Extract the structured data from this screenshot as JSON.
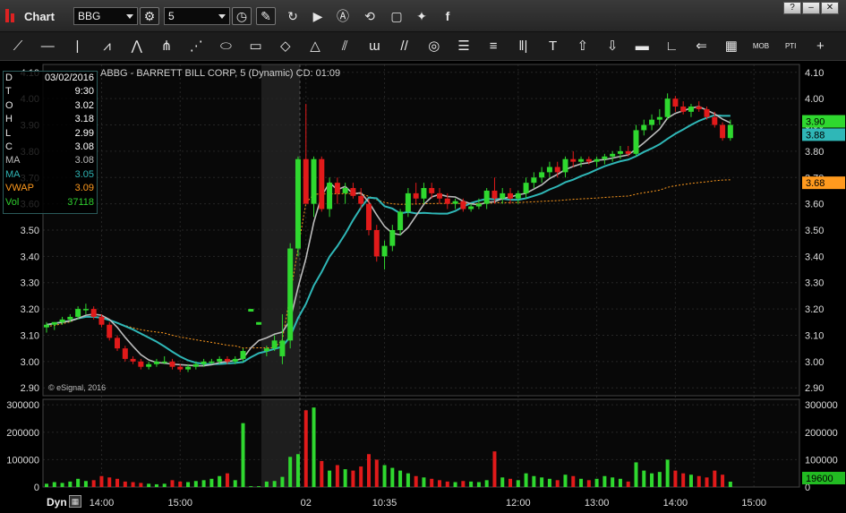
{
  "window": {
    "title": "Chart"
  },
  "toolbar": {
    "symbol": "BBG",
    "interval": "5",
    "buttons": [
      {
        "name": "settings-icon",
        "glyph": "⚙"
      },
      {
        "name": "clock-icon",
        "glyph": "◷"
      },
      {
        "name": "pencil-icon",
        "glyph": "✎"
      },
      {
        "name": "refresh-icon",
        "glyph": "↻"
      },
      {
        "name": "play-icon",
        "glyph": "▶"
      },
      {
        "name": "alert-icon",
        "glyph": "Ⓐ"
      },
      {
        "name": "link-icon",
        "glyph": "⟲"
      },
      {
        "name": "comment-icon",
        "glyph": "▢"
      },
      {
        "name": "twitter-icon",
        "glyph": "🐦"
      },
      {
        "name": "facebook-icon",
        "glyph": "f"
      }
    ],
    "window_buttons": [
      "?",
      "–",
      "□",
      "✕"
    ]
  },
  "drawing_tools": [
    {
      "name": "trendline-tool",
      "glyph": "⟋"
    },
    {
      "name": "horizontal-line-tool",
      "glyph": "—"
    },
    {
      "name": "vertical-line-tool",
      "glyph": "|"
    },
    {
      "name": "wave-tool",
      "glyph": "⩘"
    },
    {
      "name": "fan-tool",
      "glyph": "⋀"
    },
    {
      "name": "pitchfork-tool",
      "glyph": "⋔"
    },
    {
      "name": "gann-fan-tool",
      "glyph": "⋰"
    },
    {
      "name": "ellipse-tool",
      "glyph": "⬭"
    },
    {
      "name": "rectangle-tool",
      "glyph": "▭"
    },
    {
      "name": "eraser-tool",
      "glyph": "◇"
    },
    {
      "name": "triangle-tool",
      "glyph": "△"
    },
    {
      "name": "channel-tool",
      "glyph": "⫽"
    },
    {
      "name": "cycle-tool",
      "glyph": "ɯ"
    },
    {
      "name": "parallel-lines-tool",
      "glyph": "//"
    },
    {
      "name": "circles-tool",
      "glyph": "◎"
    },
    {
      "name": "fibonacci-tool",
      "glyph": "☰"
    },
    {
      "name": "fib-extension-tool",
      "glyph": "≡"
    },
    {
      "name": "time-zones-tool",
      "glyph": "‖|"
    },
    {
      "name": "text-tool",
      "glyph": "T"
    },
    {
      "name": "arrow-up-tool",
      "glyph": "⇧"
    },
    {
      "name": "arrow-down-tool",
      "glyph": "⇩"
    },
    {
      "name": "regression-tool",
      "glyph": "▬"
    },
    {
      "name": "angle-tool",
      "glyph": "∟"
    },
    {
      "name": "arrow-left-tool",
      "glyph": "⇐"
    },
    {
      "name": "grid-tool",
      "glyph": "▦"
    },
    {
      "name": "mob-tool",
      "glyph": "MOB"
    },
    {
      "name": "pti-tool",
      "glyph": "PTI"
    },
    {
      "name": "add-tool",
      "glyph": "+"
    }
  ],
  "chart_header": "ABBG - BARRETT BILL CORP, 5 (Dynamic) CD: 01:09",
  "watermark": "© eSignal, 2016",
  "data_window": [
    {
      "k": "D",
      "v": "03/02/2016",
      "color": "#ffffff"
    },
    {
      "k": "T",
      "v": "9:30",
      "color": "#ffffff"
    },
    {
      "k": "O",
      "v": "3.02",
      "color": "#ffffff"
    },
    {
      "k": "H",
      "v": "3.18",
      "color": "#ffffff"
    },
    {
      "k": "L",
      "v": "2.99",
      "color": "#ffffff"
    },
    {
      "k": "C",
      "v": "3.08",
      "color": "#ffffff"
    },
    {
      "k": "MA",
      "v": "3.08",
      "color": "#bbbbbb"
    },
    {
      "k": "MA",
      "v": "3.05",
      "color": "#2fb4b4"
    },
    {
      "k": "VWAP",
      "v": "3.09",
      "color": "#ff9a1e"
    },
    {
      "k": "Vol",
      "v": "37118",
      "color": "#2fd02f"
    }
  ],
  "bottom": {
    "mode": "Dyn"
  },
  "colors": {
    "up": "#2fd82f",
    "down": "#e11a1a",
    "ma1": "#bcbcbc",
    "ma2": "#2fb7b7",
    "vwap": "#ff9a1e",
    "vol_tag": "#22bb22",
    "vwap_tag": "#ff9a1e",
    "price_tag": "#2fd82f"
  },
  "chart_data": {
    "type": "candlestick",
    "price_axis": {
      "ylim": [
        2.87,
        4.13
      ],
      "ticks": [
        "2.90",
        "3.00",
        "3.10",
        "3.20",
        "3.30",
        "3.40",
        "3.50",
        "3.60",
        "3.70",
        "3.80",
        "3.90",
        "4.00",
        "4.10"
      ]
    },
    "volume_axis": {
      "ylim": [
        0,
        320000
      ],
      "ticks": [
        "0",
        "100000",
        "200000",
        "300000"
      ]
    },
    "x_ticks": [
      {
        "label": "14:00",
        "bar": 7
      },
      {
        "label": "15:00",
        "bar": 17
      },
      {
        "label": "02",
        "bar": 33
      },
      {
        "label": "10:35",
        "bar": 43
      },
      {
        "label": "12:00",
        "bar": 60
      },
      {
        "label": "13:00",
        "bar": 70
      },
      {
        "label": "14:00",
        "bar": 80
      },
      {
        "label": "15:00",
        "bar": 90
      }
    ],
    "last_values": {
      "price": "3.90",
      "ma2": "3.88",
      "vwap": "3.68",
      "volume": "19600"
    },
    "bars": [
      [
        3.13,
        3.15,
        3.11,
        3.14,
        12000
      ],
      [
        3.14,
        3.15,
        3.12,
        3.15,
        18000
      ],
      [
        3.15,
        3.17,
        3.14,
        3.16,
        15000
      ],
      [
        3.16,
        3.18,
        3.15,
        3.17,
        20000
      ],
      [
        3.17,
        3.21,
        3.16,
        3.2,
        30000
      ],
      [
        3.2,
        3.22,
        3.18,
        3.2,
        22000
      ],
      [
        3.2,
        3.21,
        3.16,
        3.17,
        25000
      ],
      [
        3.17,
        3.18,
        3.13,
        3.14,
        40000
      ],
      [
        3.14,
        3.15,
        3.08,
        3.09,
        35000
      ],
      [
        3.09,
        3.1,
        3.04,
        3.05,
        30000
      ],
      [
        3.05,
        3.06,
        3.0,
        3.01,
        20000
      ],
      [
        3.01,
        3.02,
        2.99,
        3.0,
        18000
      ],
      [
        3.0,
        3.01,
        2.97,
        2.98,
        15000
      ],
      [
        2.98,
        3.0,
        2.97,
        2.99,
        12000
      ],
      [
        2.99,
        3.01,
        2.98,
        3.0,
        10000
      ],
      [
        3.0,
        3.02,
        2.99,
        3.0,
        12000
      ],
      [
        3.0,
        3.01,
        2.97,
        2.98,
        25000
      ],
      [
        2.98,
        2.99,
        2.96,
        2.97,
        20000
      ],
      [
        2.97,
        2.99,
        2.96,
        2.98,
        18000
      ],
      [
        2.98,
        3.0,
        2.97,
        2.99,
        22000
      ],
      [
        2.99,
        3.01,
        2.98,
        3.0,
        25000
      ],
      [
        3.0,
        3.01,
        2.99,
        3.0,
        30000
      ],
      [
        3.0,
        3.02,
        2.99,
        3.01,
        40000
      ],
      [
        3.01,
        3.02,
        2.99,
        3.0,
        50000
      ],
      [
        3.0,
        3.02,
        2.99,
        3.01,
        25000
      ],
      [
        3.01,
        3.05,
        3.0,
        3.04,
        233000
      ],
      [
        3.19,
        3.2,
        3.19,
        3.2,
        3000
      ],
      [
        3.14,
        3.15,
        3.14,
        3.15,
        3000
      ],
      [
        3.04,
        3.06,
        3.02,
        3.05,
        20000
      ],
      [
        3.05,
        3.1,
        3.04,
        3.08,
        22000
      ],
      [
        3.02,
        3.18,
        2.99,
        3.08,
        37118
      ],
      [
        3.08,
        3.45,
        3.05,
        3.43,
        110000
      ],
      [
        3.43,
        3.78,
        3.4,
        3.77,
        120000
      ],
      [
        3.77,
        3.98,
        3.72,
        3.6,
        280000
      ],
      [
        3.6,
        3.78,
        3.55,
        3.77,
        290000
      ],
      [
        3.77,
        3.78,
        3.57,
        3.58,
        95000
      ],
      [
        3.58,
        3.7,
        3.55,
        3.68,
        60000
      ],
      [
        3.68,
        3.7,
        3.6,
        3.64,
        80000
      ],
      [
        3.64,
        3.68,
        3.6,
        3.66,
        65000
      ],
      [
        3.66,
        3.68,
        3.62,
        3.63,
        60000
      ],
      [
        3.63,
        3.66,
        3.58,
        3.6,
        75000
      ],
      [
        3.6,
        3.62,
        3.48,
        3.5,
        120000
      ],
      [
        3.5,
        3.52,
        3.38,
        3.4,
        100000
      ],
      [
        3.4,
        3.46,
        3.35,
        3.44,
        80000
      ],
      [
        3.44,
        3.52,
        3.42,
        3.5,
        70000
      ],
      [
        3.5,
        3.58,
        3.48,
        3.57,
        60000
      ],
      [
        3.57,
        3.66,
        3.55,
        3.64,
        50000
      ],
      [
        3.64,
        3.68,
        3.6,
        3.62,
        40000
      ],
      [
        3.62,
        3.68,
        3.6,
        3.66,
        35000
      ],
      [
        3.66,
        3.68,
        3.62,
        3.64,
        30000
      ],
      [
        3.64,
        3.66,
        3.6,
        3.62,
        25000
      ],
      [
        3.62,
        3.64,
        3.58,
        3.6,
        20000
      ],
      [
        3.6,
        3.62,
        3.58,
        3.61,
        18000
      ],
      [
        3.61,
        3.62,
        3.57,
        3.58,
        22000
      ],
      [
        3.58,
        3.6,
        3.57,
        3.59,
        20000
      ],
      [
        3.59,
        3.62,
        3.58,
        3.6,
        18000
      ],
      [
        3.6,
        3.66,
        3.58,
        3.65,
        25000
      ],
      [
        3.65,
        3.7,
        3.6,
        3.62,
        130000
      ],
      [
        3.62,
        3.66,
        3.6,
        3.64,
        35000
      ],
      [
        3.64,
        3.66,
        3.6,
        3.62,
        30000
      ],
      [
        3.62,
        3.65,
        3.6,
        3.64,
        25000
      ],
      [
        3.64,
        3.7,
        3.62,
        3.68,
        50000
      ],
      [
        3.68,
        3.72,
        3.66,
        3.7,
        40000
      ],
      [
        3.7,
        3.74,
        3.68,
        3.72,
        35000
      ],
      [
        3.72,
        3.76,
        3.7,
        3.74,
        30000
      ],
      [
        3.74,
        3.76,
        3.7,
        3.72,
        25000
      ],
      [
        3.72,
        3.78,
        3.7,
        3.77,
        45000
      ],
      [
        3.77,
        3.8,
        3.74,
        3.76,
        40000
      ],
      [
        3.76,
        3.78,
        3.74,
        3.77,
        30000
      ],
      [
        3.77,
        3.78,
        3.75,
        3.76,
        25000
      ],
      [
        3.76,
        3.78,
        3.74,
        3.77,
        30000
      ],
      [
        3.77,
        3.79,
        3.75,
        3.78,
        40000
      ],
      [
        3.78,
        3.8,
        3.76,
        3.79,
        35000
      ],
      [
        3.79,
        3.82,
        3.77,
        3.8,
        30000
      ],
      [
        3.8,
        3.82,
        3.78,
        3.79,
        20000
      ],
      [
        3.79,
        3.9,
        3.78,
        3.88,
        90000
      ],
      [
        3.88,
        3.92,
        3.86,
        3.9,
        60000
      ],
      [
        3.9,
        3.94,
        3.88,
        3.92,
        50000
      ],
      [
        3.92,
        3.96,
        3.9,
        3.93,
        55000
      ],
      [
        3.93,
        4.02,
        3.92,
        4.0,
        100000
      ],
      [
        4.0,
        4.01,
        3.95,
        3.97,
        60000
      ],
      [
        3.97,
        3.99,
        3.94,
        3.95,
        50000
      ],
      [
        3.95,
        3.98,
        3.93,
        3.97,
        45000
      ],
      [
        3.97,
        3.99,
        3.95,
        3.96,
        40000
      ],
      [
        3.96,
        3.97,
        3.92,
        3.93,
        35000
      ],
      [
        3.93,
        3.95,
        3.89,
        3.9,
        60000
      ],
      [
        3.9,
        3.91,
        3.84,
        3.85,
        45000
      ],
      [
        3.85,
        3.92,
        3.84,
        3.9,
        19600
      ]
    ]
  }
}
